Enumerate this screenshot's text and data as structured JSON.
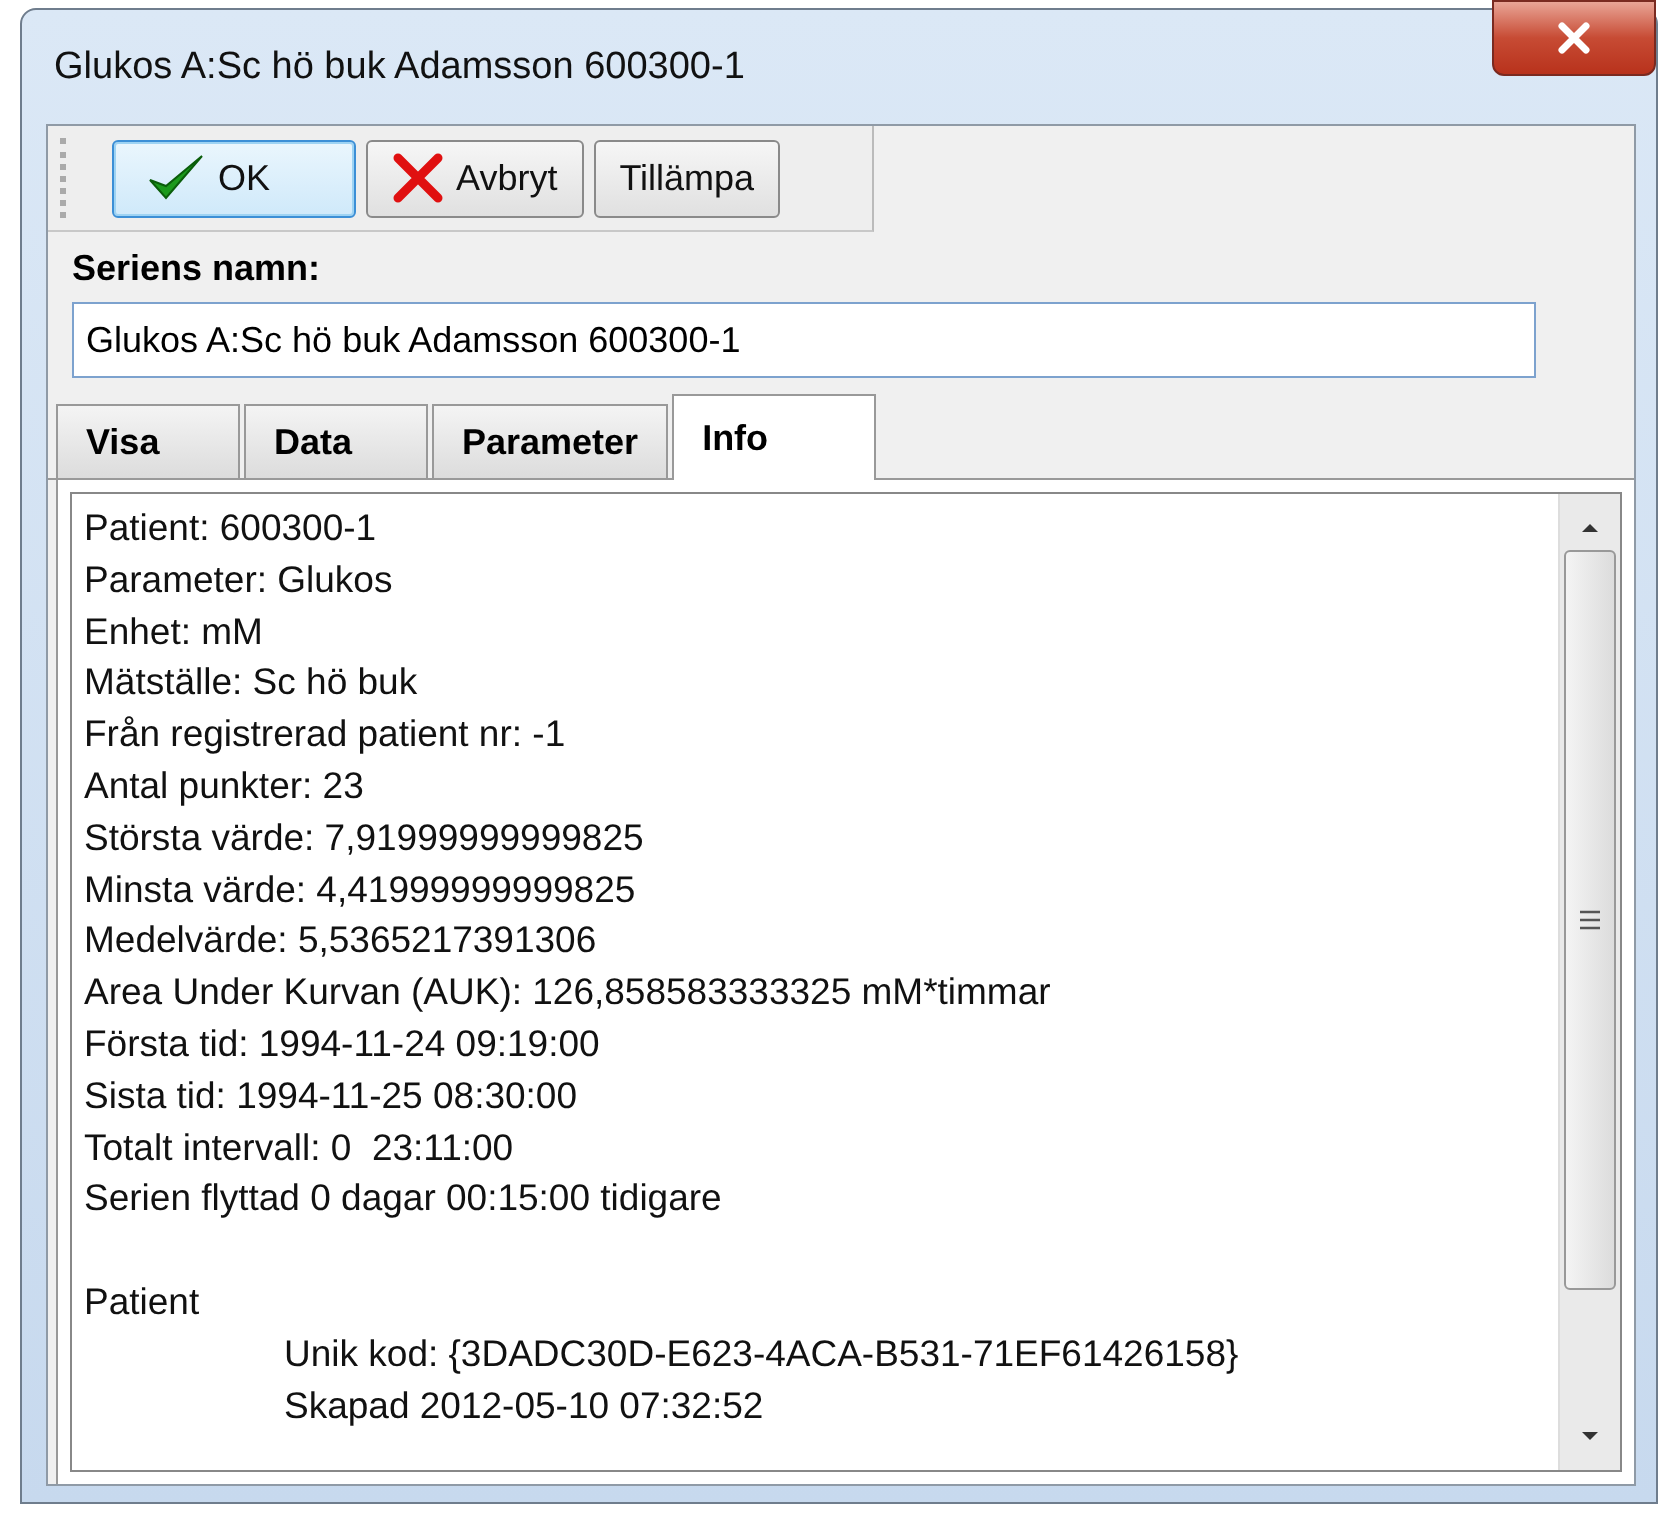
{
  "window": {
    "title": "Glukos A:Sc hö buk Adamsson 600300-1"
  },
  "toolbar": [
    {
      "kind": "ok",
      "label": "OK",
      "focused": true
    },
    {
      "kind": "cancel",
      "label": "Avbryt",
      "focused": false
    },
    {
      "kind": "plain",
      "label": "Tillämpa",
      "focused": false
    }
  ],
  "series_name": {
    "label": "Seriens namn:",
    "value": "Glukos A:Sc hö buk Adamsson 600300-1"
  },
  "tabs": [
    {
      "label": "Visa",
      "selected": false
    },
    {
      "label": "Data",
      "selected": false
    },
    {
      "label": "Parameter",
      "selected": false
    },
    {
      "label": "Info",
      "selected": true
    }
  ],
  "info": {
    "lines": [
      "Patient: 600300-1",
      "Parameter: Glukos",
      "Enhet: mM",
      "Mätställe: Sc hö buk",
      "Från registrerad patient nr: -1",
      "Antal punkter: 23",
      "Största värde: 7,91999999999825",
      "Minsta värde: 4,41999999999825",
      "Medelvärde: 5,5365217391306",
      "Area Under Kurvan (AUK): 126,858583333325 mM*timmar",
      "Första tid: 1994-11-24 09:19:00",
      "Sista tid: 1994-11-25 08:30:00",
      "Totalt intervall: 0  23:11:00",
      "Serien flyttad 0 dagar 00:15:00 tidigare"
    ],
    "sections": [
      {
        "heading": "Patient",
        "children": [
          "Unik kod: {3DADC30D-E623-4ACA-B531-71EF61426158}",
          "Skapad 2012-05-10 07:32:52"
        ]
      }
    ]
  }
}
